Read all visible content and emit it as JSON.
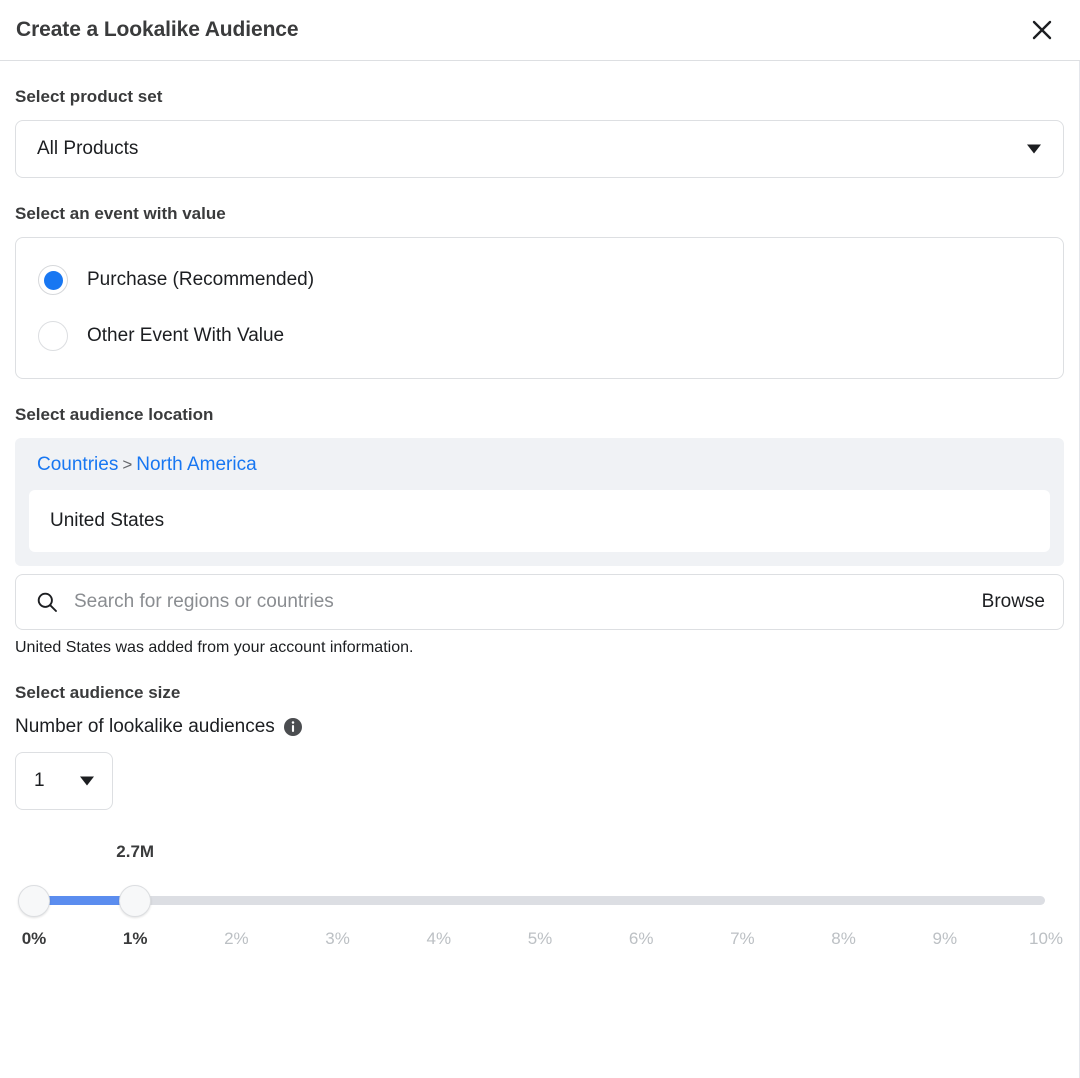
{
  "header": {
    "title": "Create a Lookalike Audience",
    "close_icon": "close-icon"
  },
  "product_set": {
    "label": "Select product set",
    "selected": "All Products",
    "caret_icon": "chevron-down-icon"
  },
  "event": {
    "label": "Select an event with value",
    "options": [
      {
        "label": "Purchase (Recommended)",
        "selected": true
      },
      {
        "label": "Other Event With Value",
        "selected": false
      }
    ]
  },
  "location": {
    "label": "Select audience location",
    "breadcrumb": {
      "root": "Countries",
      "separator": ">",
      "current": "North America"
    },
    "selected_chip": "United States",
    "search": {
      "icon": "search-icon",
      "placeholder": "Search for regions or countries",
      "value": "",
      "browse_label": "Browse"
    },
    "helper_text": "United States was added from your account information."
  },
  "audience_size": {
    "label": "Select audience size",
    "count_label": "Number of lookalike audiences",
    "info_icon": "info-icon",
    "count_value": "1",
    "caret_icon": "chevron-down-icon",
    "slider": {
      "bubble_value": "2.7M",
      "bubble_at_percent": 1,
      "range_start_percent": 0,
      "range_end_percent": 1,
      "min": 0,
      "max": 10,
      "ticks": [
        {
          "label": "0%",
          "value": 0,
          "active": true
        },
        {
          "label": "1%",
          "value": 1,
          "active": true
        },
        {
          "label": "2%",
          "value": 2,
          "active": false
        },
        {
          "label": "3%",
          "value": 3,
          "active": false
        },
        {
          "label": "4%",
          "value": 4,
          "active": false
        },
        {
          "label": "5%",
          "value": 5,
          "active": false
        },
        {
          "label": "6%",
          "value": 6,
          "active": false
        },
        {
          "label": "7%",
          "value": 7,
          "active": false
        },
        {
          "label": "8%",
          "value": 8,
          "active": false
        },
        {
          "label": "9%",
          "value": 9,
          "active": false
        },
        {
          "label": "10%",
          "value": 10,
          "active": false
        }
      ]
    }
  },
  "colors": {
    "accent_blue": "#1877f2",
    "slider_blue": "#5b8def",
    "text_primary": "#1c1e21",
    "text_muted": "#bcc0c4",
    "panel_gray": "#f0f2f5"
  }
}
